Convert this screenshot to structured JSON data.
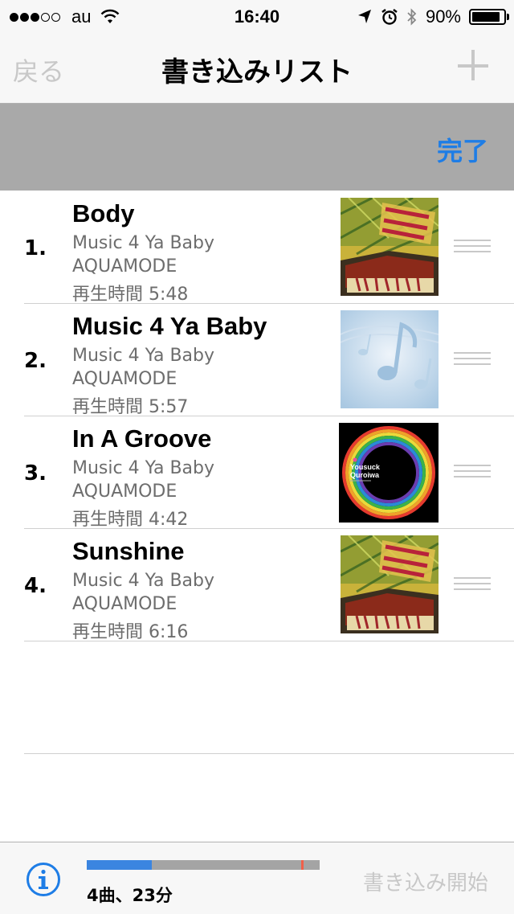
{
  "status_bar": {
    "carrier": "au",
    "time": "16:40",
    "battery": "90%",
    "battery_level": 0.9,
    "signal_strength": 3,
    "signal_max": 5
  },
  "nav": {
    "back_label": "戻る",
    "title": "書き込みリスト",
    "add_icon": "plus-icon"
  },
  "edit_bar": {
    "done_label": "完了"
  },
  "tracks": [
    {
      "num": "1.",
      "title": "Body",
      "album": "Music 4 Ya Baby",
      "artist": "AQUAMODE",
      "duration": "再生時間 5:48",
      "art": "music4yababy-art"
    },
    {
      "num": "2.",
      "title": "Music 4 Ya Baby",
      "album": "Music 4 Ya Baby",
      "artist": "AQUAMODE",
      "duration": "再生時間 5:57",
      "art": "music-notes-art"
    },
    {
      "num": "3.",
      "title": "In A Groove",
      "album": "Music 4 Ya Baby",
      "artist": "AQUAMODE",
      "duration": "再生時間 4:42",
      "art": "rainbow-ring-art"
    },
    {
      "num": "4.",
      "title": "Sunshine",
      "album": "Music 4 Ya Baby",
      "artist": "AQUAMODE",
      "duration": "再生時間 6:16",
      "art": "music4yababy-art"
    }
  ],
  "art_text": {
    "yousuck": "Yousuck",
    "quroiwa": "Quroiwa"
  },
  "toolbar": {
    "summary": "4曲、23分",
    "start_label": "書き込み開始",
    "capacity_used": 0.28,
    "capacity_mark": 0.92
  },
  "colors": {
    "accent": "#1e7de6",
    "disabled": "#c8c8c8",
    "edit_bar": "#a9a9a9",
    "capacity_used": "#3b85e0",
    "capacity_free": "#a4a4a4",
    "capacity_mark": "#f0604a"
  }
}
